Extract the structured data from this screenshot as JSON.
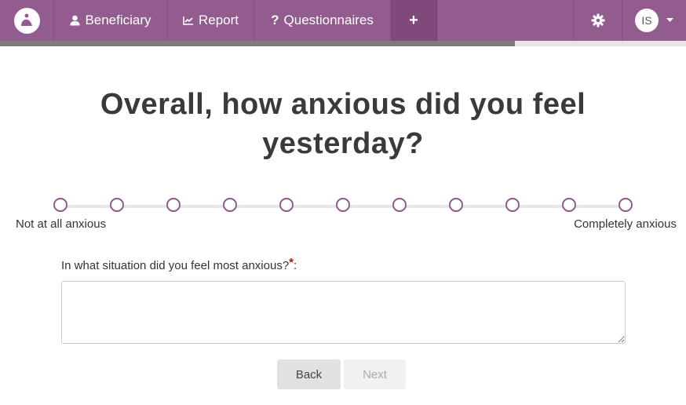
{
  "nav": {
    "beneficiary": "Beneficiary",
    "report": "Report",
    "questionnaires": "Questionnaires",
    "add_icon": "+",
    "settings_icon": "gear-icon",
    "user_initials": "IS",
    "menu_icon": "caret-down-icon"
  },
  "progress": {
    "fraction": 0.75
  },
  "question": {
    "title": "Overall, how anxious did you feel yesterday?",
    "scale": {
      "points": 11,
      "min_label": "Not at all anxious",
      "max_label": "Completely anxious"
    }
  },
  "followup": {
    "label": "In what situation did you feel most anxious?",
    "required_mark": "*",
    "suffix": ":",
    "value": ""
  },
  "buttons": {
    "back": "Back",
    "next": "Next"
  },
  "colors": {
    "header": "#935c8f",
    "active_nav": "#7f4a7b",
    "scale_point": "#8d5a8c",
    "required": "#d9001b"
  }
}
